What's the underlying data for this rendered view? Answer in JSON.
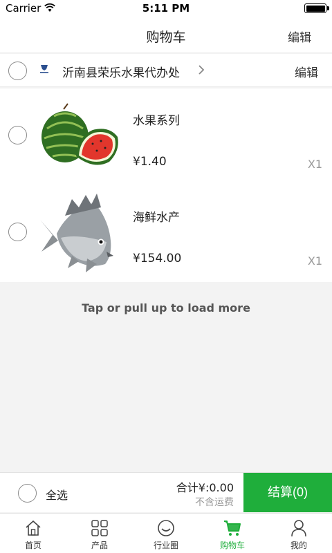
{
  "status_bar": {
    "carrier": "Carrier",
    "time": "5:11 PM"
  },
  "header": {
    "title": "购物车",
    "edit_label": "编辑"
  },
  "store": {
    "name": "沂南县荣乐水果代办处",
    "edit_label": "编辑"
  },
  "items": [
    {
      "name": "水果系列",
      "price": "¥1.40",
      "quantity": "X1",
      "image": "watermelon"
    },
    {
      "name": "海鲜水产",
      "price": "¥154.00",
      "quantity": "X1",
      "image": "fish"
    }
  ],
  "load_more": "Tap or pull up to load more",
  "footer": {
    "select_all_label": "全选",
    "total_label": "合计¥:0.00",
    "shipping_note": "不含运费",
    "checkout_label": "结算(0)"
  },
  "tabs": [
    {
      "label": "首页",
      "icon": "home-icon",
      "active": false
    },
    {
      "label": "产品",
      "icon": "grid-icon",
      "active": false
    },
    {
      "label": "行业圈",
      "icon": "smiley-icon",
      "active": false
    },
    {
      "label": "购物车",
      "icon": "cart-icon",
      "active": true
    },
    {
      "label": "我的",
      "icon": "user-icon",
      "active": false
    }
  ],
  "colors": {
    "accent": "#1fae3b",
    "background": "#f3f3f3"
  }
}
